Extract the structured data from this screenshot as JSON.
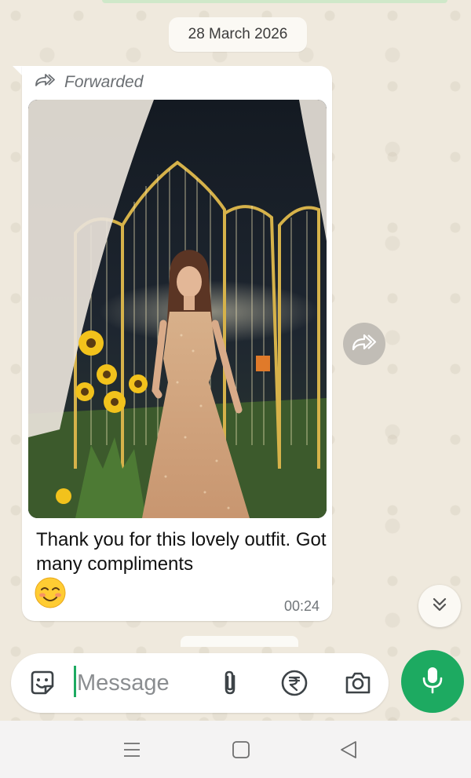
{
  "chat": {
    "date_chip": "28 March 2026"
  },
  "message": {
    "forwarded_label": "Forwarded",
    "photo": "woman-in-gold-sequin-gown-at-decorated-venue",
    "text": "Thank you for this lovely outfit. Got many compliments",
    "emoji": "smiling-face-with-blushing-eyes",
    "time": "00:24"
  },
  "composer": {
    "placeholder": "Message",
    "icons": [
      "sticker-icon",
      "attach-icon",
      "rupee-payment-icon",
      "camera-icon",
      "mic-icon"
    ]
  },
  "navbar": {
    "icons": [
      "menu-icon",
      "home-icon",
      "back-icon"
    ]
  },
  "colors": {
    "accent": "#1daa61",
    "chat_background": "#efe9dd",
    "bubble": "#ffffff"
  }
}
